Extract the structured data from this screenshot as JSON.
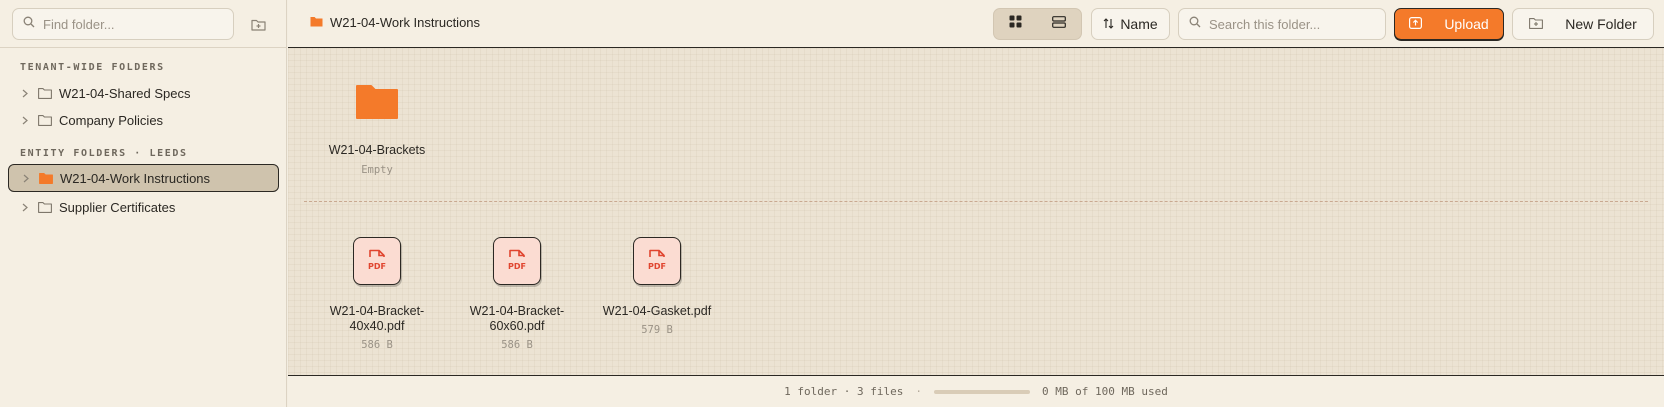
{
  "sidebar": {
    "find_placeholder": "Find folder...",
    "sections": [
      {
        "label": "TENANT-WIDE FOLDERS",
        "items": [
          {
            "label": "W21-04-Shared Specs"
          },
          {
            "label": "Company Policies"
          }
        ]
      },
      {
        "label": "ENTITY FOLDERS · LEEDS",
        "items": [
          {
            "label": "W21-04-Work Instructions",
            "active": true
          },
          {
            "label": "Supplier Certificates"
          }
        ]
      }
    ]
  },
  "header": {
    "breadcrumb": "W21-04-Work Instructions",
    "view_mode": "grid",
    "sort_label": "Name",
    "search_placeholder": "Search this folder...",
    "upload_label": "Upload",
    "new_folder_label": "New Folder"
  },
  "main": {
    "folders": [
      {
        "name": "W21-04-Brackets",
        "meta": "Empty"
      }
    ],
    "files": [
      {
        "name_line1": "W21-04-Bracket-",
        "name_line2": "40x40.pdf",
        "size": "586 B",
        "icon_label": "PDF"
      },
      {
        "name_line1": "W21-04-Bracket-",
        "name_line2": "60x60.pdf",
        "size": "586 B",
        "icon_label": "PDF"
      },
      {
        "name_line1": "W21-04-Gasket.pdf",
        "name_line2": "",
        "size": "579 B",
        "icon_label": "PDF"
      }
    ]
  },
  "footer": {
    "counts": "1 folder · 3 files",
    "separator": "·",
    "usage_text": "0 MB of 100 MB used",
    "usage_fraction": 0
  },
  "colors": {
    "accent": "#f47a2a",
    "pdf_red": "#e0452f",
    "folder_orange": "#f47a2a"
  }
}
